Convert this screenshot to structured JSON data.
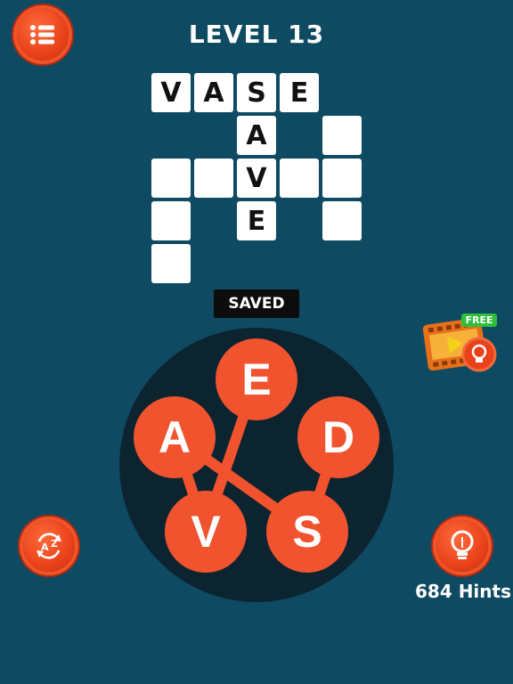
{
  "header": {
    "level_title": "LEVEL 13"
  },
  "grid": {
    "cells": [
      {
        "letter": "V"
      },
      {
        "letter": "A"
      },
      {
        "letter": "S"
      },
      {
        "letter": "E"
      },
      {
        "letter": "A"
      },
      {
        "letter": ""
      },
      {
        "letter": ""
      },
      {
        "letter": ""
      },
      {
        "letter": "V"
      },
      {
        "letter": ""
      },
      {
        "letter": ""
      },
      {
        "letter": ""
      },
      {
        "letter": "E"
      },
      {
        "letter": ""
      },
      {
        "letter": ""
      }
    ]
  },
  "word_preview": "SAVED",
  "wheel": {
    "letters": [
      "E",
      "A",
      "D",
      "V",
      "S"
    ]
  },
  "free_video_badge": "FREE",
  "hints": {
    "count_label": "684 Hints"
  },
  "colors": {
    "background": "#0f4a63",
    "accent": "#f0532d",
    "wheel": "#0c2430"
  }
}
